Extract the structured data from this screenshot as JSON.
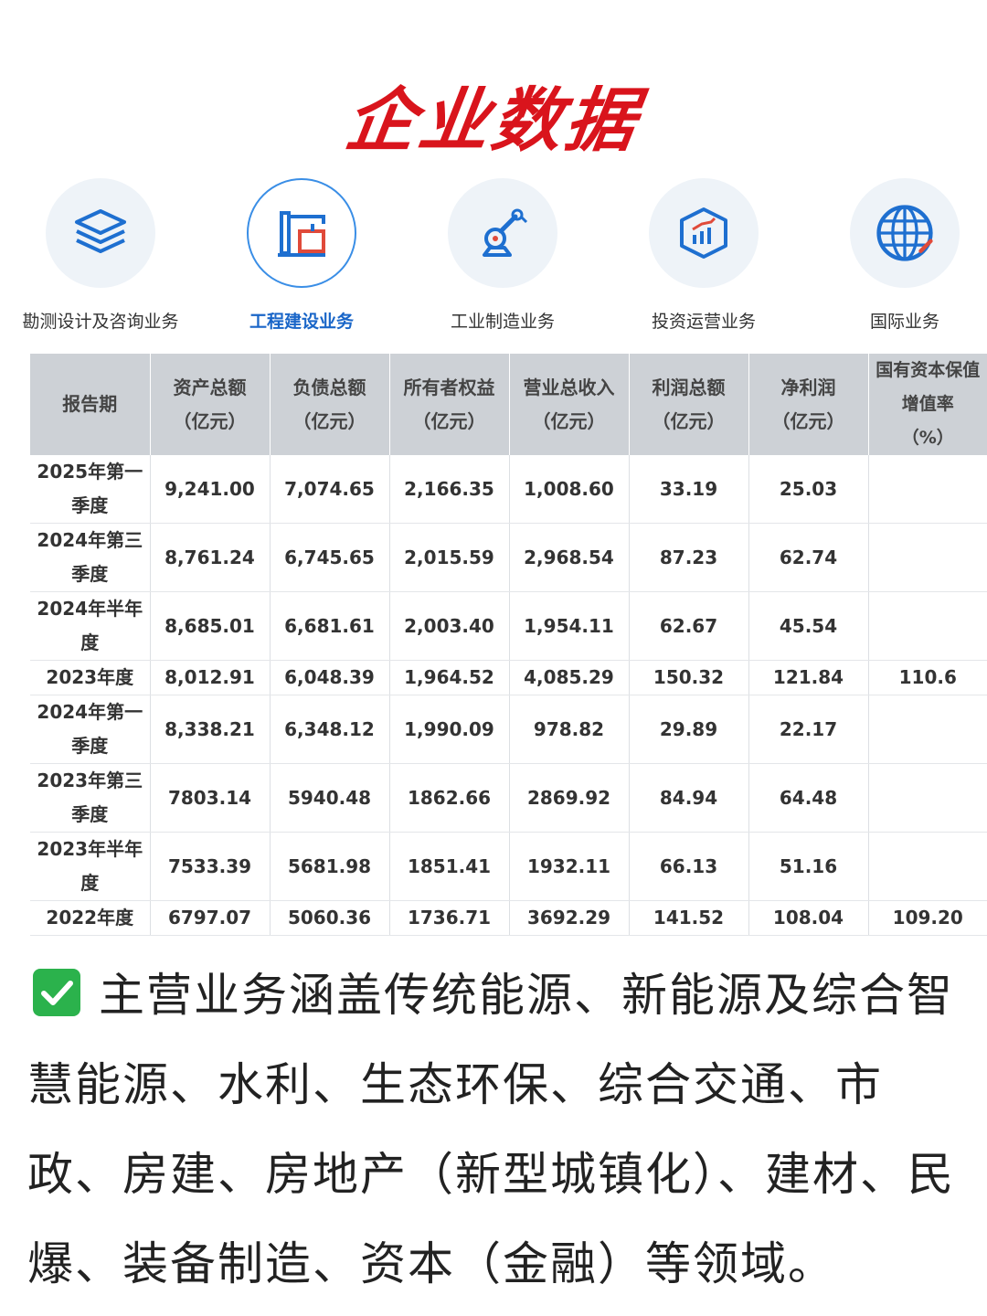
{
  "title": "企业数据",
  "nav": {
    "items": [
      {
        "label": "勘测设计及咨询业务",
        "icon": "layers-icon",
        "active": false
      },
      {
        "label": "工程建设业务",
        "icon": "crane-icon",
        "active": true
      },
      {
        "label": "工业制造业务",
        "icon": "robot-arm-icon",
        "active": false
      },
      {
        "label": "投资运营业务",
        "icon": "investment-chart-icon",
        "active": false
      },
      {
        "label": "国际业务",
        "icon": "globe-icon",
        "active": false
      }
    ]
  },
  "colors": {
    "title": "#d9141c",
    "accent": "#1a66c8",
    "check": "#2bb24c",
    "header_bg": "#cdd1d6"
  },
  "table": {
    "headers": [
      {
        "line1": "报告期",
        "line2": "",
        "line3": ""
      },
      {
        "line1": "资产总额",
        "line2": "（亿元）",
        "line3": ""
      },
      {
        "line1": "负债总额",
        "line2": "（亿元）",
        "line3": ""
      },
      {
        "line1": "所有者权益",
        "line2": "（亿元）",
        "line3": ""
      },
      {
        "line1": "营业总收入",
        "line2": "（亿元）",
        "line3": ""
      },
      {
        "line1": "利润总额",
        "line2": "（亿元）",
        "line3": ""
      },
      {
        "line1": "净利润",
        "line2": "（亿元）",
        "line3": ""
      },
      {
        "line1": "国有资本保值",
        "line2": "增值率",
        "line3": "（%）"
      }
    ],
    "rows": [
      {
        "p1": "2025年第一",
        "p2": "季度",
        "cells": [
          "9,241.00",
          "7,074.65",
          "2,166.35",
          "1,008.60",
          "33.19",
          "25.03",
          ""
        ]
      },
      {
        "p1": "2024年第三",
        "p2": "季度",
        "cells": [
          "8,761.24",
          "6,745.65",
          "2,015.59",
          "2,968.54",
          "87.23",
          "62.74",
          ""
        ]
      },
      {
        "p1": "2024年半年",
        "p2": "度",
        "cells": [
          "8,685.01",
          "6,681.61",
          "2,003.40",
          "1,954.11",
          "62.67",
          "45.54",
          ""
        ]
      },
      {
        "p1": "2023年度",
        "p2": "",
        "cells": [
          "8,012.91",
          "6,048.39",
          "1,964.52",
          "4,085.29",
          "150.32",
          "121.84",
          "110.6"
        ]
      },
      {
        "p1": "2024年第一",
        "p2": "季度",
        "cells": [
          "8,338.21",
          "6,348.12",
          "1,990.09",
          "978.82",
          "29.89",
          "22.17",
          ""
        ]
      },
      {
        "p1": "2023年第三",
        "p2": "季度",
        "cells": [
          "7803.14",
          "5940.48",
          "1862.66",
          "2869.92",
          "84.94",
          "64.48",
          ""
        ]
      },
      {
        "p1": "2023年半年",
        "p2": "度",
        "cells": [
          "7533.39",
          "5681.98",
          "1851.41",
          "1932.11",
          "66.13",
          "51.16",
          ""
        ]
      },
      {
        "p1": "2022年度",
        "p2": "",
        "cells": [
          "6797.07",
          "5060.36",
          "1736.71",
          "3692.29",
          "141.52",
          "108.04",
          "109.20"
        ]
      }
    ]
  },
  "description": "主营业务涵盖传统能源、新能源及综合智慧能源、水利、生态环保、综合交通、市政、房建、房地产（新型城镇化）、建材、民爆、装备制造、资本（金融）等领域。"
}
